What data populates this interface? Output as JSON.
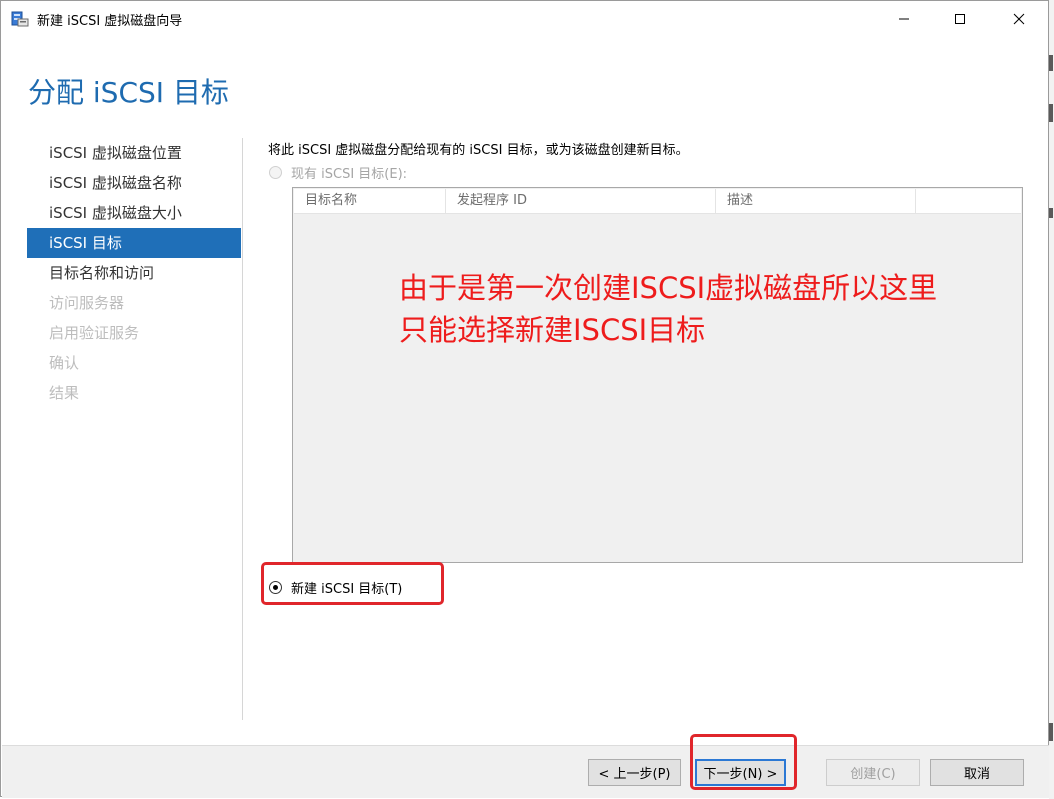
{
  "window": {
    "title": "新建 iSCSI 虚拟磁盘向导",
    "controls": {
      "minimize": "minimize",
      "maximize": "maximize",
      "close": "close"
    }
  },
  "page": {
    "title": "分配 iSCSI 目标"
  },
  "sidebar": {
    "items": [
      {
        "label": "iSCSI 虚拟磁盘位置",
        "state": "normal"
      },
      {
        "label": "iSCSI 虚拟磁盘名称",
        "state": "normal"
      },
      {
        "label": "iSCSI 虚拟磁盘大小",
        "state": "normal"
      },
      {
        "label": "iSCSI 目标",
        "state": "active"
      },
      {
        "label": "目标名称和访问",
        "state": "normal"
      },
      {
        "label": "访问服务器",
        "state": "disabled"
      },
      {
        "label": "启用验证服务",
        "state": "disabled"
      },
      {
        "label": "确认",
        "state": "disabled"
      },
      {
        "label": "结果",
        "state": "disabled"
      }
    ]
  },
  "main": {
    "description": "将此 iSCSI 虚拟磁盘分配给现有的 iSCSI 目标，或为该磁盘创建新目标。",
    "existing_target_option": {
      "label": "现有 iSCSI 目标(E):",
      "selected": false,
      "enabled": false
    },
    "targets_table": {
      "columns": [
        "目标名称",
        "发起程序 ID",
        "描述"
      ],
      "rows": []
    },
    "new_target_option": {
      "label": "新建 iSCSI 目标(T)",
      "selected": true,
      "enabled": true
    }
  },
  "annotation": {
    "line1": "由于是第一次创建ISCSI虚拟磁盘所以这里",
    "line2": "只能选择新建ISCSI目标",
    "color": "#ee1c1c"
  },
  "footer": {
    "prev_label": "< 上一步(P)",
    "next_label": "下一步(N) >",
    "create_label": "创建(C)",
    "cancel_label": "取消"
  },
  "colors": {
    "accent": "#1f6fb8",
    "title": "#1e6bb0",
    "highlight_box": "#e0262b"
  }
}
